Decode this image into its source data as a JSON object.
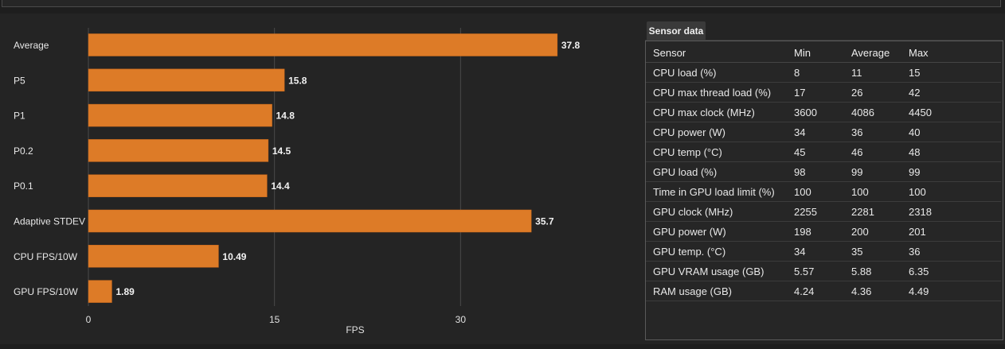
{
  "chart_data": {
    "type": "bar",
    "orientation": "horizontal",
    "categories": [
      "Average",
      "P5",
      "P1",
      "P0.2",
      "P0.1",
      "Adaptive STDEV",
      "CPU FPS/10W",
      "GPU FPS/10W"
    ],
    "values": [
      37.8,
      15.8,
      14.8,
      14.5,
      14.4,
      35.7,
      10.49,
      1.89
    ],
    "value_labels": [
      "37.8",
      "15.8",
      "14.8",
      "14.5",
      "14.4",
      "35.7",
      "10.49",
      "1.89"
    ],
    "xlabel": "FPS",
    "xticks": [
      0,
      15,
      30
    ],
    "xlim": [
      0,
      41.5
    ],
    "grid": true,
    "bar_color": "#dd7b27"
  },
  "sensor_tab": {
    "label": "Sensor data"
  },
  "sensor_table": {
    "headers": [
      "Sensor",
      "Min",
      "Average",
      "Max"
    ],
    "rows": [
      [
        "CPU load (%)",
        "8",
        "11",
        "15"
      ],
      [
        "CPU max thread load (%)",
        "17",
        "26",
        "42"
      ],
      [
        "CPU max clock (MHz)",
        "3600",
        "4086",
        "4450"
      ],
      [
        "CPU power (W)",
        "34",
        "36",
        "40"
      ],
      [
        "CPU temp (°C)",
        "45",
        "46",
        "48"
      ],
      [
        "GPU load (%)",
        "98",
        "99",
        "99"
      ],
      [
        "Time in GPU load limit (%)",
        "100",
        "100",
        "100"
      ],
      [
        "GPU clock (MHz)",
        "2255",
        "2281",
        "2318"
      ],
      [
        "GPU power (W)",
        "198",
        "200",
        "201"
      ],
      [
        "GPU temp. (°C)",
        "34",
        "35",
        "36"
      ],
      [
        "GPU VRAM usage (GB)",
        "5.57",
        "5.88",
        "6.35"
      ],
      [
        "RAM usage (GB)",
        "4.24",
        "4.36",
        "4.49"
      ]
    ]
  }
}
